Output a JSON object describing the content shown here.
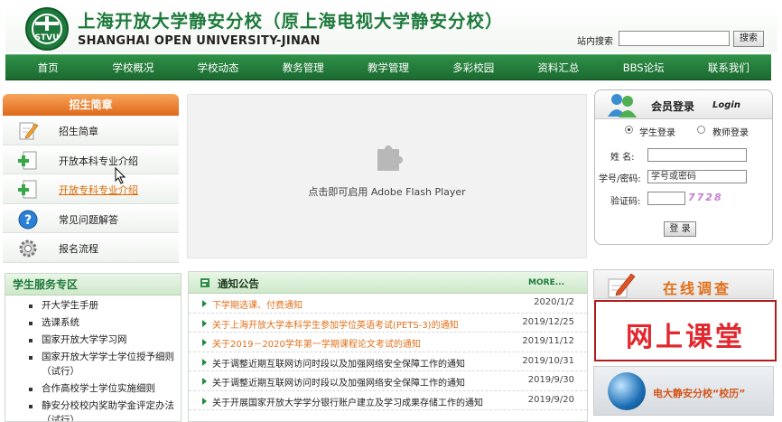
{
  "header": {
    "title": "上海开放大学静安分校（原上海电视大学静安分校）",
    "subtitle": "SHANGHAI OPEN UNIVERSITY-JINAN",
    "logo_text": "STVU",
    "search_label": "站内搜索",
    "search_button": "搜索"
  },
  "nav": [
    "首页",
    "学校概况",
    "学校动态",
    "教务管理",
    "教学管理",
    "多彩校园",
    "资料汇总",
    "BBS论坛",
    "联系我们"
  ],
  "admissions": {
    "title": "招生简章",
    "items": [
      {
        "label": "招生简章",
        "icon": "edit-icon"
      },
      {
        "label": "开放本科专业介绍",
        "icon": "document-add-icon"
      },
      {
        "label": "开放专科专业介绍",
        "icon": "document-add-icon"
      },
      {
        "label": "常见问题解答",
        "icon": "help-icon"
      },
      {
        "label": "报名流程",
        "icon": "gear-icon"
      }
    ]
  },
  "flash": {
    "text": "点击即可启用 Adobe Flash Player"
  },
  "login": {
    "title": "会员登录",
    "title_en": "Login",
    "radio_student": "学生登录",
    "radio_teacher": "教师登录",
    "name_label": "姓  名:",
    "id_label": "学号/密码:",
    "id_placeholder": "学号或密码",
    "captcha_label": "验证码:",
    "captcha_code": "7728",
    "submit": "登 录"
  },
  "services": {
    "title": "学生服务专区",
    "items": [
      "开大学生手册",
      "选课系统",
      "国家开放大学学习网",
      "国家开放大学学士学位授予细则（试行）",
      "合作高校学士学位实施细则",
      "静安分校校内奖助学金评定办法（试行）"
    ]
  },
  "notices": {
    "title": "通知公告",
    "more": "MORE...",
    "highlight_color": "#e0701a",
    "items": [
      {
        "text": "下学期选课、付费通知",
        "date": "2020/1/2",
        "highlight": true
      },
      {
        "text": "关于上海开放大学本科学生参加学位英语考试(PETS-3)的通知",
        "date": "2019/12/25",
        "highlight": true
      },
      {
        "text": "关于2019－2020学年第一学期课程论文考试的通知",
        "date": "2019/11/12",
        "highlight": true
      },
      {
        "text": "关于调整近期互联网访问时段以及加强网络安全保障工作的通知",
        "date": "2019/10/31",
        "highlight": false
      },
      {
        "text": "关于调整近期互联网访问时段以及加强网络安全保障工作的通知",
        "date": "2019/9/30",
        "highlight": false
      },
      {
        "text": "关于开展国家开放大学学分银行账户建立及学习成果存储工作的通知",
        "date": "2019/9/20",
        "highlight": false
      }
    ]
  },
  "banners": {
    "survey": "在线调查",
    "classroom": "网上课堂",
    "history": "电大静安分校“校历”"
  }
}
